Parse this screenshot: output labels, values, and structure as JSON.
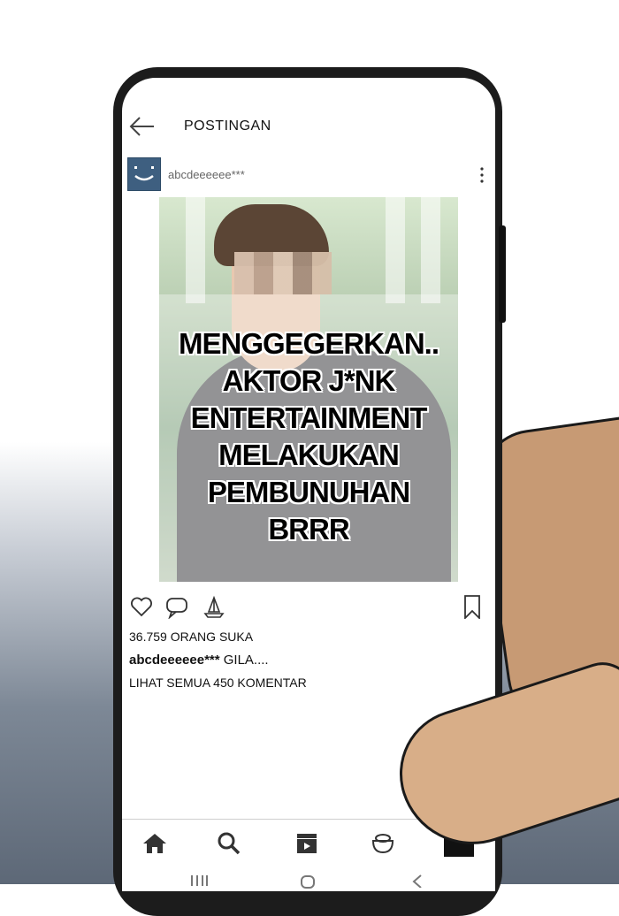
{
  "header": {
    "title": "POSTINGAN"
  },
  "post": {
    "username": "abcdeeeeee***",
    "headline_lines": [
      "MENGGEGERKAN..",
      "AKTOR J*NK",
      "ENTERTAINMENT",
      "MELAKUKAN",
      "PEMBUNUHAN",
      "BRRR"
    ],
    "likes_text": "36.759 ORANG SUKA",
    "caption_user": "abcdeeeeee***",
    "caption_text": " GILA....",
    "comments_text": "LIHAT SEMUA 450 KOMENTAR"
  },
  "icons": {
    "back": "back-arrow-icon",
    "more": "more-vertical-icon",
    "like": "heart-icon",
    "comment": "comment-icon",
    "share": "send-icon",
    "save": "bookmark-icon",
    "home": "home-icon",
    "search": "search-icon",
    "reels": "video-icon",
    "shop": "shop-icon",
    "profile": "profile-icon"
  },
  "colors": {
    "avatar": "#3e5f80",
    "text": "#111111"
  }
}
